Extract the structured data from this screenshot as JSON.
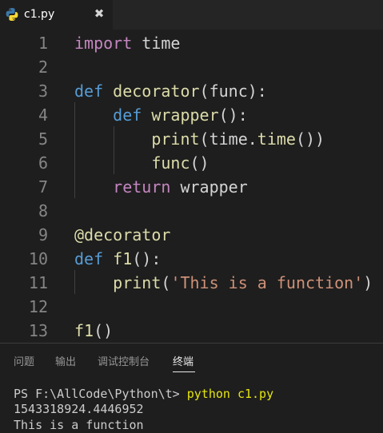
{
  "tab": {
    "filename": "c1.py",
    "close_glyph": "✖",
    "icon": "python-icon"
  },
  "editor": {
    "line_numbers": [
      "1",
      "2",
      "3",
      "4",
      "5",
      "6",
      "7",
      "8",
      "9",
      "10",
      "11",
      "12",
      "13"
    ],
    "lines": [
      [
        {
          "t": "import",
          "c": "ctl"
        },
        {
          "t": " time",
          "c": "txt"
        }
      ],
      [],
      [
        {
          "t": "def",
          "c": "kw"
        },
        {
          "t": " ",
          "c": "txt"
        },
        {
          "t": "decorator",
          "c": "fn"
        },
        {
          "t": "(func):",
          "c": "txt"
        }
      ],
      [
        {
          "t": "    ",
          "c": "txt"
        },
        {
          "t": "def",
          "c": "kw"
        },
        {
          "t": " ",
          "c": "txt"
        },
        {
          "t": "wrapper",
          "c": "fn"
        },
        {
          "t": "():",
          "c": "txt"
        }
      ],
      [
        {
          "t": "        ",
          "c": "txt"
        },
        {
          "t": "print",
          "c": "fn"
        },
        {
          "t": "(time.",
          "c": "txt"
        },
        {
          "t": "time",
          "c": "fn"
        },
        {
          "t": "())",
          "c": "txt"
        }
      ],
      [
        {
          "t": "        ",
          "c": "txt"
        },
        {
          "t": "func",
          "c": "fn"
        },
        {
          "t": "()",
          "c": "txt"
        }
      ],
      [
        {
          "t": "    ",
          "c": "txt"
        },
        {
          "t": "return",
          "c": "ctl"
        },
        {
          "t": " wrapper",
          "c": "txt"
        }
      ],
      [],
      [
        {
          "t": "@decorator",
          "c": "fn"
        }
      ],
      [
        {
          "t": "def",
          "c": "kw"
        },
        {
          "t": " ",
          "c": "txt"
        },
        {
          "t": "f1",
          "c": "fn"
        },
        {
          "t": "():",
          "c": "txt"
        }
      ],
      [
        {
          "t": "    ",
          "c": "txt"
        },
        {
          "t": "print",
          "c": "fn"
        },
        {
          "t": "(",
          "c": "txt"
        },
        {
          "t": "'This is a function'",
          "c": "str"
        },
        {
          "t": ")",
          "c": "txt"
        }
      ],
      [],
      [
        {
          "t": "f1",
          "c": "fn"
        },
        {
          "t": "()",
          "c": "txt"
        }
      ]
    ]
  },
  "panel": {
    "tabs": [
      "问题",
      "输出",
      "调试控制台",
      "终端"
    ],
    "active_tab": "终端",
    "terminal": {
      "prompt": "PS F:\\AllCode\\Python\\t> ",
      "command": "python c1.py",
      "output": [
        "1543318924.4446952",
        "This is a function"
      ]
    }
  }
}
